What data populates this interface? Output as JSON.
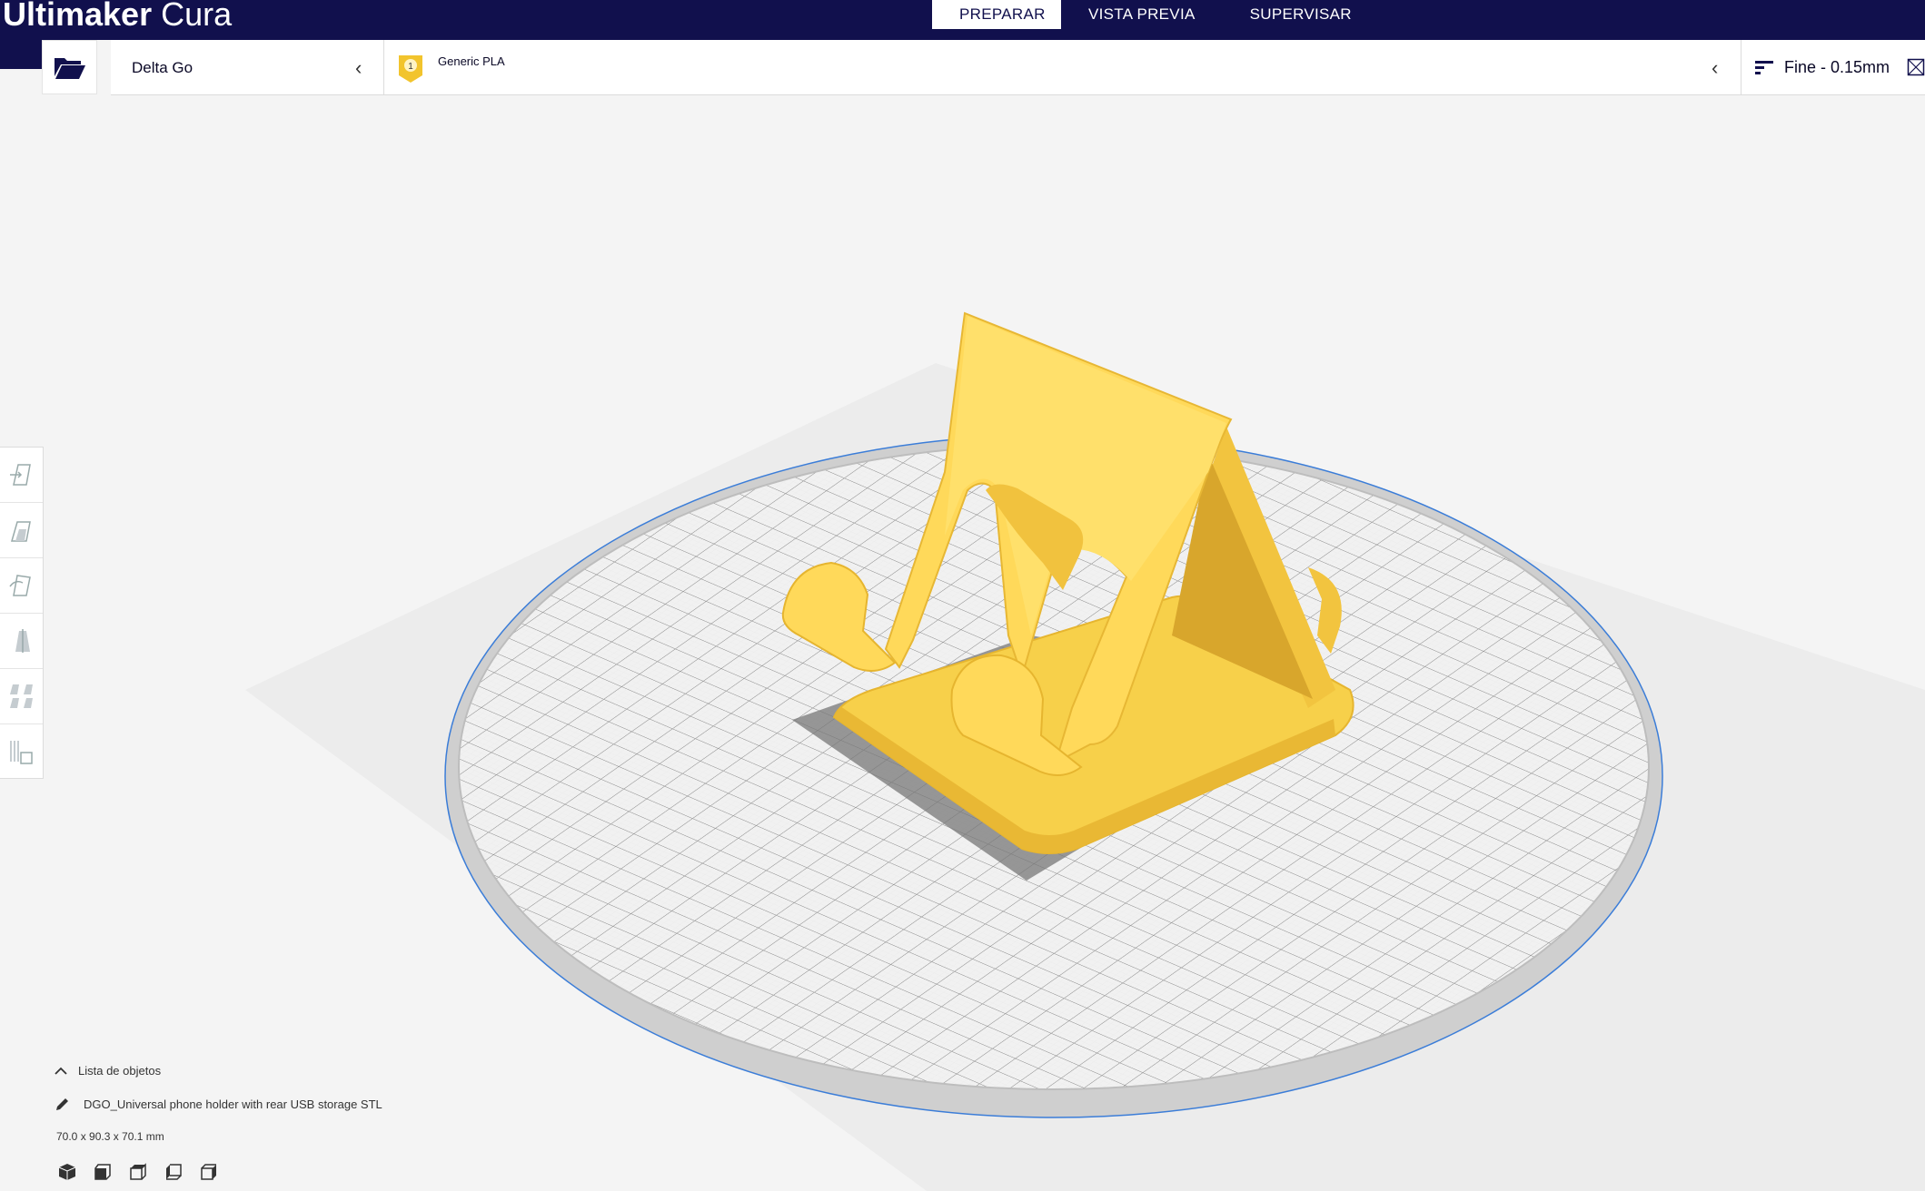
{
  "app": {
    "brand_bold": "Ultimaker",
    "brand_light": "Cura"
  },
  "tabs": [
    {
      "label": "PREPARAR",
      "active": true
    },
    {
      "label": "VISTA PREVIA",
      "active": false
    },
    {
      "label": "SUPERVISAR",
      "active": false
    }
  ],
  "toolbar": {
    "printer": "Delta Go",
    "extruder_number": "1",
    "material": "Generic PLA",
    "profile": "Fine - 0.15mm"
  },
  "tools": [
    {
      "icon": "move-icon"
    },
    {
      "icon": "scale-icon"
    },
    {
      "icon": "rotate-icon"
    },
    {
      "icon": "mirror-icon"
    },
    {
      "icon": "per-model-settings-icon"
    },
    {
      "icon": "support-blocker-icon"
    }
  ],
  "object_list": {
    "title": "Lista de objetos",
    "object_name": "DGO_Universal phone holder with rear USB storage STL",
    "dimensions": "70.0 x 90.3 x 70.1 mm"
  },
  "view_buttons": [
    {
      "icon": "view-3d-icon"
    },
    {
      "icon": "view-front-icon"
    },
    {
      "icon": "view-top-icon"
    },
    {
      "icon": "view-left-icon"
    },
    {
      "icon": "view-right-icon"
    }
  ],
  "colors": {
    "header": "#11104d",
    "model": "#ffd95a",
    "extruder_badge": "#f2c42d",
    "buildplate_edge": "#3b7dd8"
  }
}
